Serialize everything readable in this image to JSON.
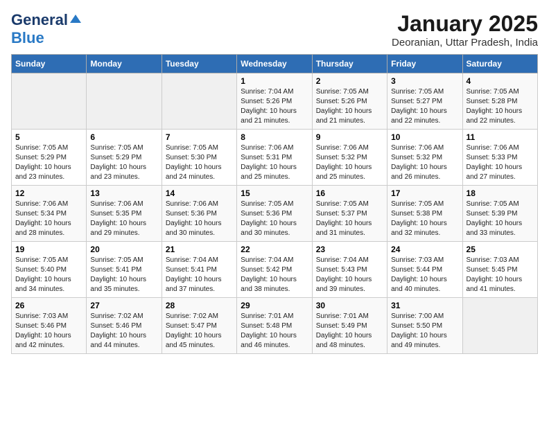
{
  "header": {
    "logo_line1": "General",
    "logo_line2": "Blue",
    "title": "January 2025",
    "subtitle": "Deoranian, Uttar Pradesh, India"
  },
  "days_of_week": [
    "Sunday",
    "Monday",
    "Tuesday",
    "Wednesday",
    "Thursday",
    "Friday",
    "Saturday"
  ],
  "weeks": [
    [
      {
        "day": "",
        "info": ""
      },
      {
        "day": "",
        "info": ""
      },
      {
        "day": "",
        "info": ""
      },
      {
        "day": "1",
        "info": "Sunrise: 7:04 AM\nSunset: 5:26 PM\nDaylight: 10 hours\nand 21 minutes."
      },
      {
        "day": "2",
        "info": "Sunrise: 7:05 AM\nSunset: 5:26 PM\nDaylight: 10 hours\nand 21 minutes."
      },
      {
        "day": "3",
        "info": "Sunrise: 7:05 AM\nSunset: 5:27 PM\nDaylight: 10 hours\nand 22 minutes."
      },
      {
        "day": "4",
        "info": "Sunrise: 7:05 AM\nSunset: 5:28 PM\nDaylight: 10 hours\nand 22 minutes."
      }
    ],
    [
      {
        "day": "5",
        "info": "Sunrise: 7:05 AM\nSunset: 5:29 PM\nDaylight: 10 hours\nand 23 minutes."
      },
      {
        "day": "6",
        "info": "Sunrise: 7:05 AM\nSunset: 5:29 PM\nDaylight: 10 hours\nand 23 minutes."
      },
      {
        "day": "7",
        "info": "Sunrise: 7:05 AM\nSunset: 5:30 PM\nDaylight: 10 hours\nand 24 minutes."
      },
      {
        "day": "8",
        "info": "Sunrise: 7:06 AM\nSunset: 5:31 PM\nDaylight: 10 hours\nand 25 minutes."
      },
      {
        "day": "9",
        "info": "Sunrise: 7:06 AM\nSunset: 5:32 PM\nDaylight: 10 hours\nand 25 minutes."
      },
      {
        "day": "10",
        "info": "Sunrise: 7:06 AM\nSunset: 5:32 PM\nDaylight: 10 hours\nand 26 minutes."
      },
      {
        "day": "11",
        "info": "Sunrise: 7:06 AM\nSunset: 5:33 PM\nDaylight: 10 hours\nand 27 minutes."
      }
    ],
    [
      {
        "day": "12",
        "info": "Sunrise: 7:06 AM\nSunset: 5:34 PM\nDaylight: 10 hours\nand 28 minutes."
      },
      {
        "day": "13",
        "info": "Sunrise: 7:06 AM\nSunset: 5:35 PM\nDaylight: 10 hours\nand 29 minutes."
      },
      {
        "day": "14",
        "info": "Sunrise: 7:06 AM\nSunset: 5:36 PM\nDaylight: 10 hours\nand 30 minutes."
      },
      {
        "day": "15",
        "info": "Sunrise: 7:05 AM\nSunset: 5:36 PM\nDaylight: 10 hours\nand 30 minutes."
      },
      {
        "day": "16",
        "info": "Sunrise: 7:05 AM\nSunset: 5:37 PM\nDaylight: 10 hours\nand 31 minutes."
      },
      {
        "day": "17",
        "info": "Sunrise: 7:05 AM\nSunset: 5:38 PM\nDaylight: 10 hours\nand 32 minutes."
      },
      {
        "day": "18",
        "info": "Sunrise: 7:05 AM\nSunset: 5:39 PM\nDaylight: 10 hours\nand 33 minutes."
      }
    ],
    [
      {
        "day": "19",
        "info": "Sunrise: 7:05 AM\nSunset: 5:40 PM\nDaylight: 10 hours\nand 34 minutes."
      },
      {
        "day": "20",
        "info": "Sunrise: 7:05 AM\nSunset: 5:41 PM\nDaylight: 10 hours\nand 35 minutes."
      },
      {
        "day": "21",
        "info": "Sunrise: 7:04 AM\nSunset: 5:41 PM\nDaylight: 10 hours\nand 37 minutes."
      },
      {
        "day": "22",
        "info": "Sunrise: 7:04 AM\nSunset: 5:42 PM\nDaylight: 10 hours\nand 38 minutes."
      },
      {
        "day": "23",
        "info": "Sunrise: 7:04 AM\nSunset: 5:43 PM\nDaylight: 10 hours\nand 39 minutes."
      },
      {
        "day": "24",
        "info": "Sunrise: 7:03 AM\nSunset: 5:44 PM\nDaylight: 10 hours\nand 40 minutes."
      },
      {
        "day": "25",
        "info": "Sunrise: 7:03 AM\nSunset: 5:45 PM\nDaylight: 10 hours\nand 41 minutes."
      }
    ],
    [
      {
        "day": "26",
        "info": "Sunrise: 7:03 AM\nSunset: 5:46 PM\nDaylight: 10 hours\nand 42 minutes."
      },
      {
        "day": "27",
        "info": "Sunrise: 7:02 AM\nSunset: 5:46 PM\nDaylight: 10 hours\nand 44 minutes."
      },
      {
        "day": "28",
        "info": "Sunrise: 7:02 AM\nSunset: 5:47 PM\nDaylight: 10 hours\nand 45 minutes."
      },
      {
        "day": "29",
        "info": "Sunrise: 7:01 AM\nSunset: 5:48 PM\nDaylight: 10 hours\nand 46 minutes."
      },
      {
        "day": "30",
        "info": "Sunrise: 7:01 AM\nSunset: 5:49 PM\nDaylight: 10 hours\nand 48 minutes."
      },
      {
        "day": "31",
        "info": "Sunrise: 7:00 AM\nSunset: 5:50 PM\nDaylight: 10 hours\nand 49 minutes."
      },
      {
        "day": "",
        "info": ""
      }
    ]
  ]
}
